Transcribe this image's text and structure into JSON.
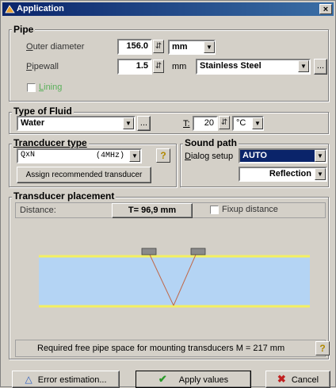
{
  "window": {
    "title": "Application",
    "close": "×"
  },
  "pipe": {
    "group_title": "Pipe",
    "outer_diameter": {
      "label": "Outer diameter",
      "value": "156.0",
      "unit": "mm"
    },
    "pipewall": {
      "label": "Pipewall",
      "value": "1.5",
      "unit": "mm",
      "material": "Stainless Steel",
      "browse": "..."
    },
    "lining": {
      "label": "Lining",
      "checked": false
    }
  },
  "fluid": {
    "group_title": "Type of Fluid",
    "value": "Water",
    "browse": "...",
    "temp_label": "T:",
    "temp_value": "20",
    "temp_unit": "°C"
  },
  "transducer": {
    "group_title": "Trancducer type",
    "type": "QxN",
    "freq": "(4MHz)",
    "help": "?",
    "assign_button": "Assign recommended transducer"
  },
  "sound_path": {
    "group_title": "Sound path",
    "dialog_label": "Dialog setup",
    "mode": "AUTO",
    "path": "Reflection"
  },
  "placement": {
    "group_title": "Transducer placement",
    "distance_label": "Distance:",
    "distance_value": "T= 96,9 mm",
    "fixup_label": "Fixup distance",
    "fixup_checked": false,
    "required_text": "Required free pipe space for mounting transducers M  = 217 mm",
    "help": "?"
  },
  "buttons": {
    "error": "Error estimation...",
    "apply": "Apply values",
    "cancel": "Cancel"
  },
  "colors": {
    "pipe_fill": "#b4d4f4",
    "pipe_wall": "#f4f060",
    "beam": "#c06848",
    "transducer": "#8a8a8a",
    "titlebar": "#0a246a"
  }
}
